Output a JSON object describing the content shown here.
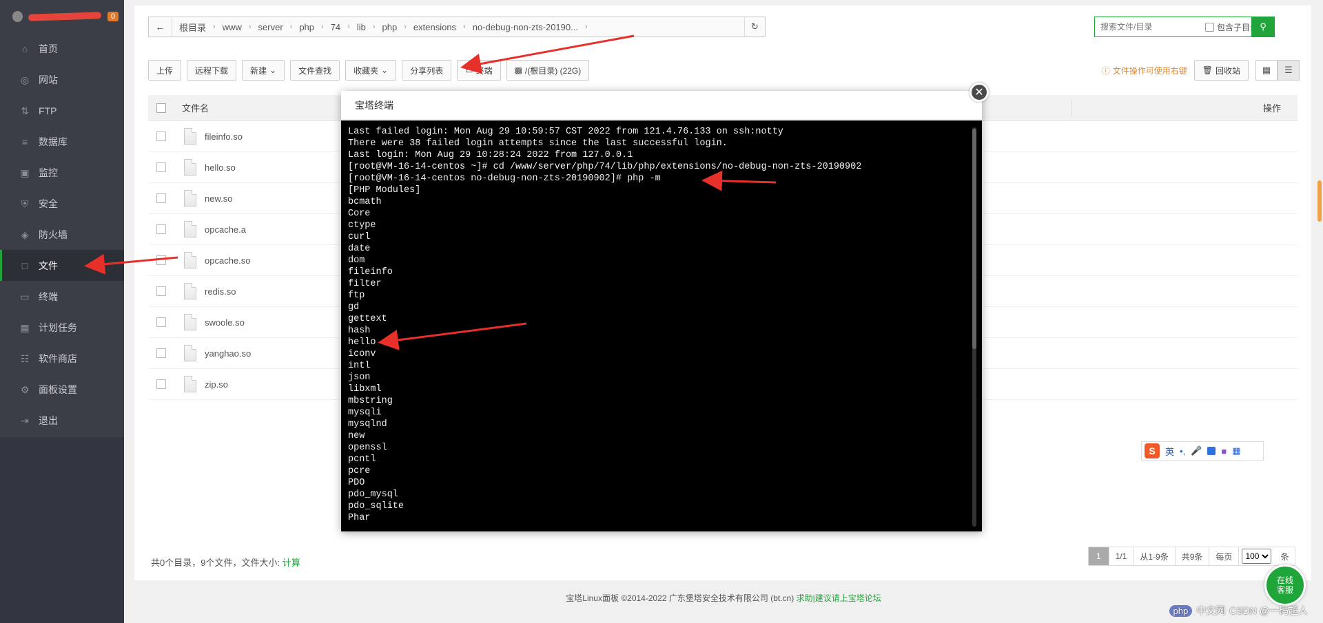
{
  "sidebar": {
    "badge": "0",
    "items": [
      {
        "label": "首页",
        "icon": "home-icon"
      },
      {
        "label": "网站",
        "icon": "globe-icon"
      },
      {
        "label": "FTP",
        "icon": "ftp-icon"
      },
      {
        "label": "数据库",
        "icon": "database-icon"
      },
      {
        "label": "监控",
        "icon": "monitor-icon"
      },
      {
        "label": "安全",
        "icon": "shield-icon"
      },
      {
        "label": "防火墙",
        "icon": "firewall-icon"
      },
      {
        "label": "文件",
        "icon": "folder-icon"
      },
      {
        "label": "终端",
        "icon": "terminal-icon"
      },
      {
        "label": "计划任务",
        "icon": "calendar-icon"
      },
      {
        "label": "软件商店",
        "icon": "grid-icon"
      },
      {
        "label": "面板设置",
        "icon": "gear-icon"
      },
      {
        "label": "退出",
        "icon": "logout-icon"
      }
    ],
    "active_index": 7
  },
  "path": {
    "crumbs": [
      "根目录",
      "www",
      "server",
      "php",
      "74",
      "lib",
      "php",
      "extensions",
      "no-debug-non-zts-20190..."
    ]
  },
  "search": {
    "placeholder": "搜索文件/目录",
    "include_subdir": "包含子目录"
  },
  "toolbar": {
    "upload": "上传",
    "remote_download": "远程下载",
    "new": "新建",
    "file_search": "文件查找",
    "favorites": "收藏夹",
    "share_list": "分享列表",
    "terminal": "终端",
    "disk": "/(根目录) (22G)",
    "hint": "文件操作可使用右键",
    "recycle": "回收站"
  },
  "table": {
    "col_name": "文件名",
    "col_ops": "操作",
    "files": [
      "fileinfo.so",
      "hello.so",
      "new.so",
      "opcache.a",
      "opcache.so",
      "redis.so",
      "swoole.so",
      "yanghao.so",
      "zip.so"
    ]
  },
  "footer": {
    "summary": "共0个目录，9个文件，文件大小:",
    "calc": "计算",
    "page_current": "1",
    "page_total": "1/1",
    "range": "从1-9条",
    "count": "共9条",
    "per_page_label": "每页",
    "per_page": "100",
    "per_page_unit": "条"
  },
  "copyright": {
    "text": "宝塔Linux面板 ©2014-2022 广东堡塔安全技术有限公司 (bt.cn)",
    "link": "求助|建议请上宝塔论坛"
  },
  "modal": {
    "title": "宝塔终端",
    "lines": [
      "Last failed login: Mon Aug 29 10:59:57 CST 2022 from 121.4.76.133 on ssh:notty",
      "There were 38 failed login attempts since the last successful login.",
      "Last login: Mon Aug 29 10:28:24 2022 from 127.0.0.1",
      "[root@VM-16-14-centos ~]# cd /www/server/php/74/lib/php/extensions/no-debug-non-zts-20190902",
      "[root@VM-16-14-centos no-debug-non-zts-20190902]# php -m",
      "[PHP Modules]",
      "bcmath",
      "Core",
      "ctype",
      "curl",
      "date",
      "dom",
      "fileinfo",
      "filter",
      "ftp",
      "gd",
      "gettext",
      "hash",
      "hello",
      "iconv",
      "intl",
      "json",
      "libxml",
      "mbstring",
      "mysqli",
      "mysqlnd",
      "new",
      "openssl",
      "pcntl",
      "pcre",
      "PDO",
      "pdo_mysql",
      "pdo_sqlite",
      "Phar"
    ]
  },
  "ime": {
    "logo": "S",
    "lang": "英"
  },
  "service": {
    "line1": "在线",
    "line2": "客服"
  },
  "watermark": {
    "php": "php",
    "site": "中文网",
    "csdn": "CSDN @一码超人"
  },
  "colors": {
    "accent": "#20a53a",
    "sidebar": "#3b3e47",
    "annotation": "#e8302a"
  }
}
